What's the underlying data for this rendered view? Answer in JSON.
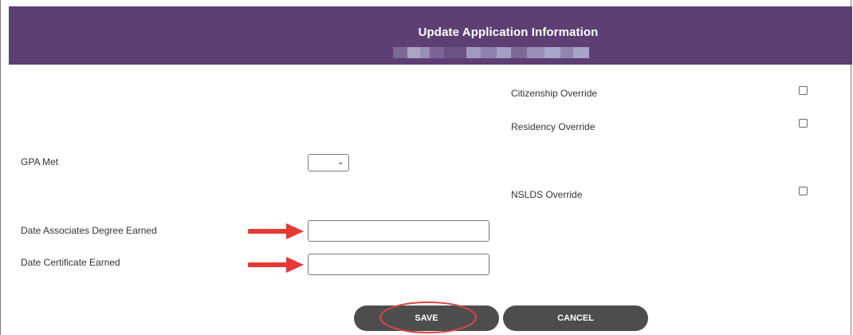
{
  "header": {
    "title": "Update Application Information",
    "bg_color": "#5e3f74"
  },
  "fields": {
    "citizenship_override": {
      "label": "Citizenship Override",
      "checked": false
    },
    "residency_override": {
      "label": "Residency Override",
      "checked": false
    },
    "gpa_met": {
      "label": "GPA Met",
      "value": ""
    },
    "nslds_override": {
      "label": "NSLDS Override",
      "checked": false
    },
    "date_associates_degree": {
      "label": "Date Associates Degree Earned",
      "value": ""
    },
    "date_certificate": {
      "label": "Date Certificate Earned",
      "value": ""
    }
  },
  "buttons": {
    "save_label": "SAVE",
    "cancel_label": "CANCEL",
    "color": "#4d4d4d"
  },
  "annotation": {
    "arrow_color": "#e53935",
    "ring_color": "#d64545"
  }
}
